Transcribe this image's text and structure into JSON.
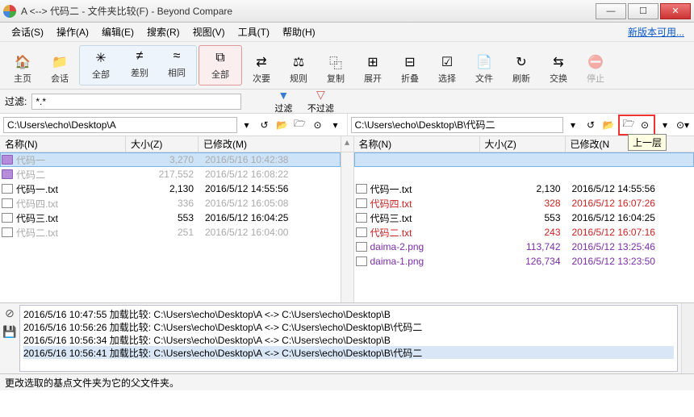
{
  "title": "A <--> 代码二 - 文件夹比较(F) - Beyond Compare",
  "update_text": "新版本可用...",
  "menu": [
    "会话(S)",
    "操作(A)",
    "编辑(E)",
    "搜索(R)",
    "视图(V)",
    "工具(T)",
    "帮助(H)"
  ],
  "toolbar": {
    "home": "主页",
    "session": "会话",
    "all": "全部",
    "diff": "差别",
    "same": "相同",
    "allmode": "全部",
    "next": "次要",
    "rules": "规则",
    "copy": "复制",
    "expand": "展开",
    "collapse": "折叠",
    "select": "选择",
    "files": "文件",
    "refresh": "刷新",
    "swap": "交换",
    "stop": "停止"
  },
  "filter": {
    "label": "过滤:",
    "value": "*.*",
    "filter_btn": "过滤",
    "nofilter_btn": "不过滤"
  },
  "paths": {
    "left": "C:\\Users\\echo\\Desktop\\A",
    "right": "C:\\Users\\echo\\Desktop\\B\\代码二"
  },
  "tooltip": "上一层",
  "cols": {
    "name_l": "名称(N)",
    "size_l": "大小(Z)",
    "mod_l": "已修改(M)",
    "name_r": "名称(N)",
    "size_r": "大小(Z)",
    "mod_r": "已修改(N"
  },
  "left_rows": [
    {
      "icon": "folder-p",
      "name": "代码一",
      "size": "3,270",
      "date": "2016/5/16 10:42:38",
      "cls": "sel ghost"
    },
    {
      "icon": "folder-p",
      "name": "代码二",
      "size": "217,552",
      "date": "2016/5/12 16:08:22",
      "cls": "ghost"
    },
    {
      "icon": "file",
      "name": "代码一.txt",
      "size": "2,130",
      "date": "2016/5/12 14:55:56",
      "cls": ""
    },
    {
      "icon": "file",
      "name": "代码四.txt",
      "size": "336",
      "date": "2016/5/12 16:05:08",
      "cls": "ghost"
    },
    {
      "icon": "file",
      "name": "代码三.txt",
      "size": "553",
      "date": "2016/5/12 16:04:25",
      "cls": ""
    },
    {
      "icon": "file",
      "name": "代码二.txt",
      "size": "251",
      "date": "2016/5/12 16:04:00",
      "cls": "ghost"
    }
  ],
  "right_rows": [
    {
      "icon": "file",
      "name": "代码一.txt",
      "size": "2,130",
      "date": "2016/5/12 14:55:56",
      "cls": ""
    },
    {
      "icon": "file",
      "name": "代码四.txt",
      "size": "328",
      "date": "2016/5/12 16:07:26",
      "cls": "red"
    },
    {
      "icon": "file",
      "name": "代码三.txt",
      "size": "553",
      "date": "2016/5/12 16:04:25",
      "cls": ""
    },
    {
      "icon": "file",
      "name": "代码二.txt",
      "size": "243",
      "date": "2016/5/12 16:07:16",
      "cls": "red"
    },
    {
      "icon": "file",
      "name": "daima-2.png",
      "size": "113,742",
      "date": "2016/5/12 13:25:46",
      "cls": "purple"
    },
    {
      "icon": "file",
      "name": "daima-1.png",
      "size": "126,734",
      "date": "2016/5/12 13:23:50",
      "cls": "purple"
    }
  ],
  "log_lines": [
    "2016/5/16 10:47:55  加载比较: C:\\Users\\echo\\Desktop\\A <-> C:\\Users\\echo\\Desktop\\B",
    "2016/5/16 10:56:26  加载比较: C:\\Users\\echo\\Desktop\\A <-> C:\\Users\\echo\\Desktop\\B\\代码二",
    "2016/5/16 10:56:34  加载比较: C:\\Users\\echo\\Desktop\\A <-> C:\\Users\\echo\\Desktop\\B",
    "2016/5/16 10:56:41  加载比较: C:\\Users\\echo\\Desktop\\A <-> C:\\Users\\echo\\Desktop\\B\\代码二"
  ],
  "status": "更改选取的基点文件夹为它的父文件夹。"
}
